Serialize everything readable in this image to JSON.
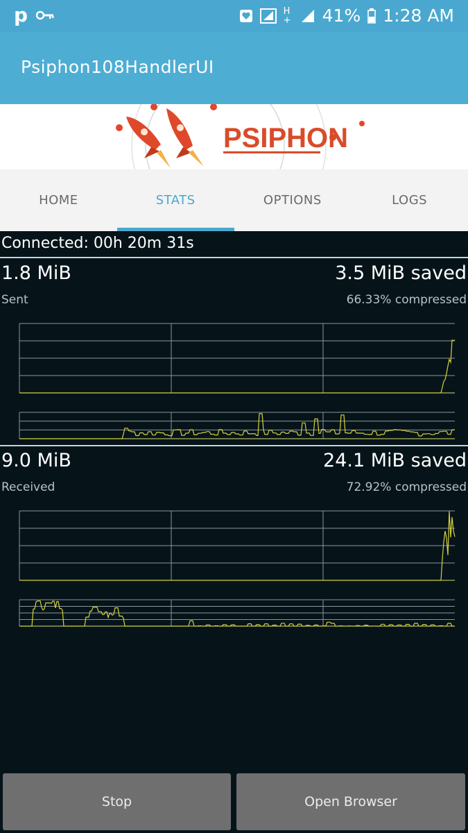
{
  "status_bar": {
    "carrier_icon": "p-letter-icon",
    "key_icon": "key-icon",
    "battery_percent": "41%",
    "time": "1:28 AM",
    "network": "H+"
  },
  "app_bar": {
    "title": "Psiphon108HandlerUI"
  },
  "banner": {
    "logo_text": "PSIPHON"
  },
  "tabs": [
    {
      "label": "HOME"
    },
    {
      "label": "STATS"
    },
    {
      "label": "OPTIONS"
    },
    {
      "label": "LOGS"
    }
  ],
  "stats": {
    "connected": "Connected: 00h 20m 31s",
    "sent": {
      "amount": "1.8 MiB",
      "label": "Sent",
      "saved": "3.5 MiB saved",
      "compressed": "66.33% compressed"
    },
    "received": {
      "amount": "9.0 MiB",
      "label": "Received",
      "saved": "24.1 MiB saved",
      "compressed": "72.92% compressed"
    }
  },
  "buttons": {
    "stop": "Stop",
    "open_browser": "Open Browser"
  },
  "colors": {
    "accent": "#4aa8d0",
    "graph_line": "#d6d23a",
    "background": "#06141a"
  }
}
